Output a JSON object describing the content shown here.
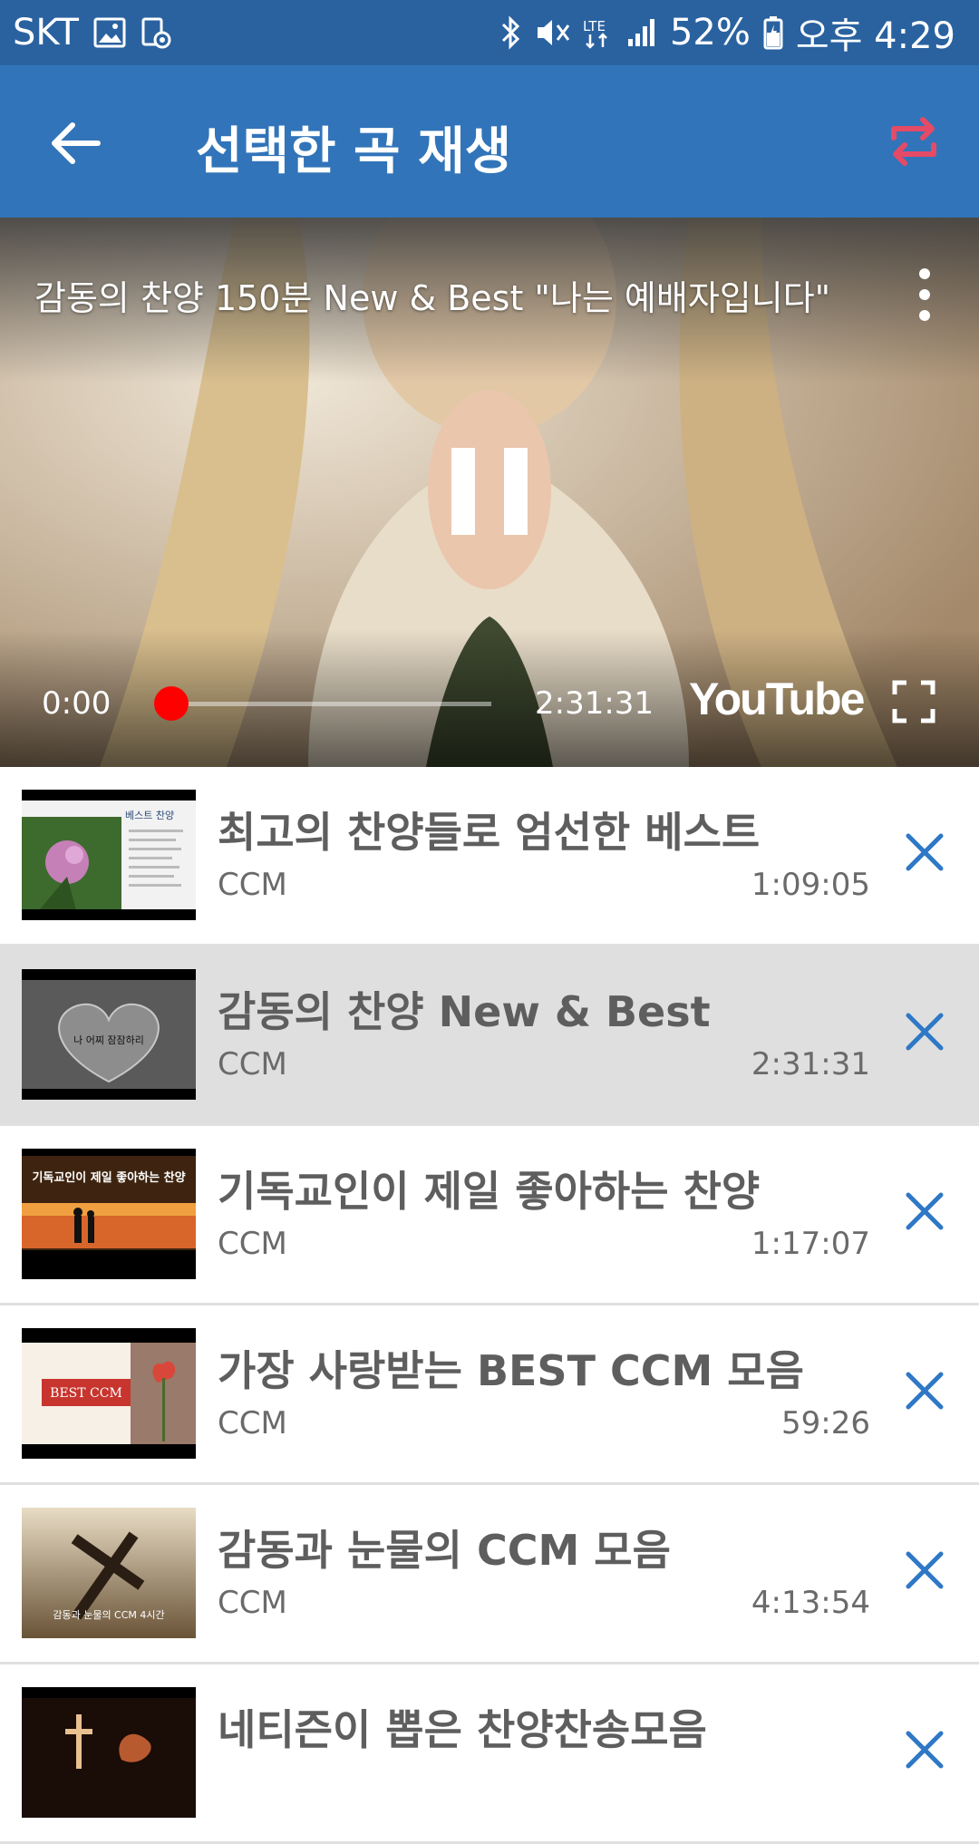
{
  "status_bar": {
    "carrier": "SKT",
    "network": "LTE",
    "battery": "52%",
    "time": "오후 4:29",
    "icons": [
      "image-icon",
      "screen-record-icon",
      "bluetooth-icon",
      "mute-icon",
      "lte-icon",
      "signal-icon",
      "battery-icon"
    ]
  },
  "appbar": {
    "title": "선택한 곡 재생",
    "back_icon": "arrow-left-icon",
    "repeat_icon": "repeat-icon",
    "colors": {
      "bar": "#3174b9",
      "repeat": "#e54a66"
    }
  },
  "player": {
    "video_title": "감동의 찬양 150분 New & Best \"나는 예배자입니다\"",
    "current_time": "0:00",
    "total_time": "2:31:31",
    "progress": 0.0,
    "brand": "YouTube",
    "accent": "#ff0000"
  },
  "playlist": [
    {
      "title": "최고의 찬양들로 엄선한 베스트",
      "category": "CCM",
      "duration": "1:09:05",
      "active": false
    },
    {
      "title": "감동의 찬양 New & Best",
      "category": "CCM",
      "duration": "2:31:31",
      "active": true
    },
    {
      "title": "기독교인이 제일 좋아하는 찬양",
      "category": "CCM",
      "duration": "1:17:07",
      "active": false
    },
    {
      "title": "가장 사랑받는 BEST CCM 모음",
      "category": "CCM",
      "duration": "59:26",
      "active": false
    },
    {
      "title": "감동과 눈물의 CCM 모음",
      "category": "CCM",
      "duration": "4:13:54",
      "active": false
    },
    {
      "title": "네티즌이 뽑은 찬양찬송모음",
      "category": "",
      "duration": "",
      "active": false
    }
  ],
  "thumb_text": {
    "t1": "베스트 찬양",
    "t2": "나 어찌 잠잠하리",
    "t3": "기독교인이 제일 좋아하는 찬양",
    "t4": "BEST CCM",
    "t5": "감동과 눈물의 CCM 4시간"
  }
}
